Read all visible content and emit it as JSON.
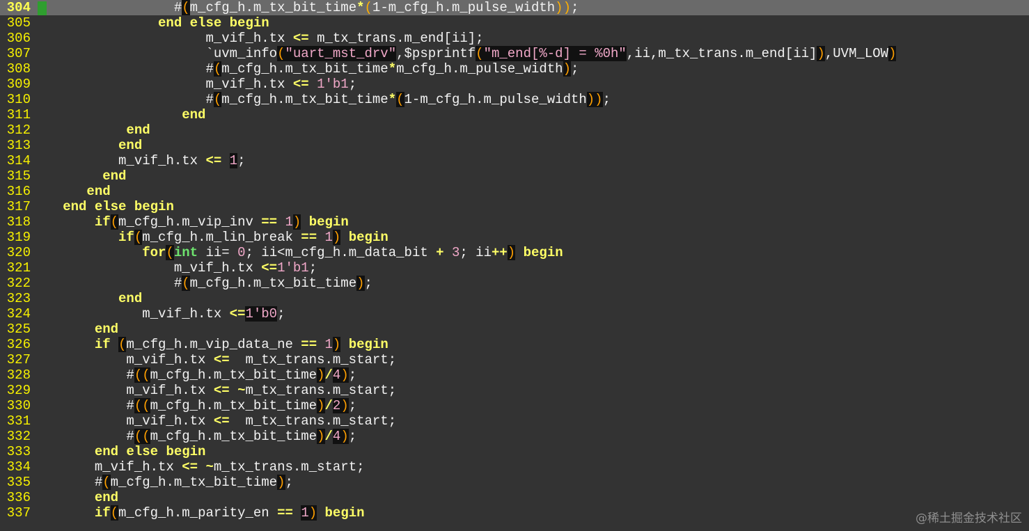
{
  "editor": {
    "current_line": 304,
    "watermark": "@稀土掘金技术社区",
    "lines": [
      {
        "n": "304",
        "indent": "                 ",
        "tokens": [
          [
            "#",
            "text"
          ],
          [
            "(",
            "paren",
            1
          ],
          [
            "m_cfg_h.m_tx_bit_time",
            "text"
          ],
          [
            "*",
            "op"
          ],
          [
            "(",
            "paren"
          ],
          [
            "1-m_cfg_h.m_pulse_width",
            "text"
          ],
          [
            "))",
            "paren"
          ],
          [
            ";",
            "text"
          ]
        ]
      },
      {
        "n": "305",
        "indent": "               ",
        "tokens": [
          [
            "end else begin",
            "kw"
          ]
        ]
      },
      {
        "n": "306",
        "indent": "                     ",
        "tokens": [
          [
            "m_vif_h.tx ",
            "text"
          ],
          [
            "<=",
            "op"
          ],
          [
            " m_tx_trans.m_end[ii];",
            "text"
          ]
        ]
      },
      {
        "n": "307",
        "indent": "                     ",
        "tokens": [
          [
            "`uvm_info",
            "text"
          ],
          [
            "(",
            "paren",
            1
          ],
          [
            "\"uart_mst_drv\"",
            "str",
            1
          ],
          [
            ",$psprintf",
            "text"
          ],
          [
            "(",
            "paren",
            1
          ],
          [
            "\"m_end[%-d] = %0h\"",
            "str",
            1
          ],
          [
            ",ii,m_tx_trans.m_end[ii]",
            "text"
          ],
          [
            ")",
            "paren",
            1
          ],
          [
            ",UVM_LOW",
            "text"
          ],
          [
            ")",
            "paren",
            1
          ]
        ]
      },
      {
        "n": "308",
        "indent": "                     ",
        "tokens": [
          [
            "#",
            "text"
          ],
          [
            "(",
            "paren",
            1
          ],
          [
            "m_cfg_h.m_tx_bit_time",
            "text"
          ],
          [
            "*",
            "op"
          ],
          [
            "m_cfg_h.m_pulse_width",
            "text"
          ],
          [
            ")",
            "paren",
            1
          ],
          [
            ";",
            "text"
          ]
        ]
      },
      {
        "n": "309",
        "indent": "                     ",
        "tokens": [
          [
            "m_vif_h.tx ",
            "text"
          ],
          [
            "<=",
            "op"
          ],
          [
            " ",
            "text"
          ],
          [
            "1'b1",
            "num"
          ],
          [
            ";",
            "text"
          ]
        ]
      },
      {
        "n": "310",
        "indent": "                     ",
        "tokens": [
          [
            "#",
            "text"
          ],
          [
            "(",
            "paren",
            1
          ],
          [
            "m_cfg_h.m_tx_bit_time",
            "text"
          ],
          [
            "*",
            "op"
          ],
          [
            "(",
            "paren",
            1
          ],
          [
            "1-m_cfg_h.m_pulse_width",
            "text"
          ],
          [
            "))",
            "paren",
            1
          ],
          [
            ";",
            "text"
          ]
        ]
      },
      {
        "n": "311",
        "indent": "                  ",
        "tokens": [
          [
            "end",
            "kw"
          ]
        ]
      },
      {
        "n": "312",
        "indent": "           ",
        "tokens": [
          [
            "end",
            "kw"
          ]
        ]
      },
      {
        "n": "313",
        "indent": "          ",
        "tokens": [
          [
            "end",
            "kw"
          ]
        ]
      },
      {
        "n": "314",
        "indent": "          ",
        "tokens": [
          [
            "m_vif_h.tx ",
            "text"
          ],
          [
            "<=",
            "op"
          ],
          [
            " ",
            "text"
          ],
          [
            "1",
            "num",
            1
          ],
          [
            ";",
            "text"
          ]
        ]
      },
      {
        "n": "315",
        "indent": "        ",
        "tokens": [
          [
            "end",
            "kw"
          ]
        ]
      },
      {
        "n": "316",
        "indent": "      ",
        "tokens": [
          [
            "end",
            "kw"
          ]
        ]
      },
      {
        "n": "317",
        "indent": "   ",
        "tokens": [
          [
            "end else begin",
            "kw"
          ]
        ]
      },
      {
        "n": "318",
        "indent": "       ",
        "tokens": [
          [
            "if",
            "kw"
          ],
          [
            "(",
            "paren",
            1
          ],
          [
            "m_cfg_h.m_vip_inv ",
            "text"
          ],
          [
            "==",
            "op"
          ],
          [
            " ",
            "text"
          ],
          [
            "1",
            "num"
          ],
          [
            ")",
            "paren",
            1
          ],
          [
            " ",
            "text"
          ],
          [
            "begin",
            "kw"
          ]
        ]
      },
      {
        "n": "319",
        "indent": "          ",
        "tokens": [
          [
            "if",
            "kw"
          ],
          [
            "(",
            "paren",
            1
          ],
          [
            "m_cfg_h.m_lin_break ",
            "text"
          ],
          [
            "==",
            "op"
          ],
          [
            " ",
            "text"
          ],
          [
            "1",
            "num"
          ],
          [
            ")",
            "paren",
            1
          ],
          [
            " ",
            "text"
          ],
          [
            "begin",
            "kw"
          ]
        ]
      },
      {
        "n": "320",
        "indent": "             ",
        "tokens": [
          [
            "for",
            "kw"
          ],
          [
            "(",
            "paren",
            1
          ],
          [
            "int",
            "type"
          ],
          [
            " ii= ",
            "text"
          ],
          [
            "0",
            "num"
          ],
          [
            "; ii<m_cfg_h.m_data_bit ",
            "text"
          ],
          [
            "+",
            "op"
          ],
          [
            " ",
            "text"
          ],
          [
            "3",
            "num"
          ],
          [
            "; ii",
            "text"
          ],
          [
            "++",
            "op"
          ],
          [
            ")",
            "paren",
            1
          ],
          [
            " ",
            "text"
          ],
          [
            "begin",
            "kw"
          ]
        ]
      },
      {
        "n": "321",
        "indent": "                 ",
        "tokens": [
          [
            "m_vif_h.tx ",
            "text"
          ],
          [
            "<=",
            "op"
          ],
          [
            "1'b1",
            "num"
          ],
          [
            ";",
            "text"
          ]
        ]
      },
      {
        "n": "322",
        "indent": "                 ",
        "tokens": [
          [
            "#",
            "text"
          ],
          [
            "(",
            "paren",
            1
          ],
          [
            "m_cfg_h.m_tx_bit_time",
            "text"
          ],
          [
            ")",
            "paren",
            1
          ],
          [
            ";",
            "text"
          ]
        ]
      },
      {
        "n": "323",
        "indent": "          ",
        "tokens": [
          [
            "end",
            "kw"
          ]
        ]
      },
      {
        "n": "324",
        "indent": "             ",
        "tokens": [
          [
            "m_vif_h.tx ",
            "text"
          ],
          [
            "<=",
            "op"
          ],
          [
            "1'b0",
            "num",
            1
          ],
          [
            ";",
            "text"
          ]
        ]
      },
      {
        "n": "325",
        "indent": "       ",
        "tokens": [
          [
            "end",
            "kw"
          ]
        ]
      },
      {
        "n": "326",
        "indent": "       ",
        "tokens": [
          [
            "if",
            "kw"
          ],
          [
            " ",
            "text"
          ],
          [
            "(",
            "paren",
            1
          ],
          [
            "m_cfg_h.m_vip_data_ne ",
            "text"
          ],
          [
            "==",
            "op"
          ],
          [
            " ",
            "text"
          ],
          [
            "1",
            "num"
          ],
          [
            ")",
            "paren",
            1
          ],
          [
            " ",
            "text"
          ],
          [
            "begin",
            "kw"
          ]
        ]
      },
      {
        "n": "327",
        "indent": "           ",
        "tokens": [
          [
            "m_vif_h.tx ",
            "text"
          ],
          [
            "<=",
            "op"
          ],
          [
            "  m_tx_trans.m_start;",
            "text"
          ]
        ]
      },
      {
        "n": "328",
        "indent": "           ",
        "tokens": [
          [
            "#",
            "text"
          ],
          [
            "((",
            "paren",
            1
          ],
          [
            "m_cfg_h.m_tx_bit_time",
            "text"
          ],
          [
            ")",
            "paren",
            1
          ],
          [
            "/",
            "op"
          ],
          [
            "4",
            "num",
            1
          ],
          [
            ")",
            "paren",
            1
          ],
          [
            ";",
            "text"
          ]
        ]
      },
      {
        "n": "329",
        "indent": "           ",
        "tokens": [
          [
            "m_vif_h.tx ",
            "text"
          ],
          [
            "<=",
            "op"
          ],
          [
            " ",
            "text"
          ],
          [
            "~",
            "op"
          ],
          [
            "m_tx_trans.m_start;",
            "text"
          ]
        ]
      },
      {
        "n": "330",
        "indent": "           ",
        "tokens": [
          [
            "#",
            "text"
          ],
          [
            "((",
            "paren",
            1
          ],
          [
            "m_cfg_h.m_tx_bit_time",
            "text"
          ],
          [
            ")",
            "paren",
            1
          ],
          [
            "/",
            "op"
          ],
          [
            "2",
            "num",
            1
          ],
          [
            ")",
            "paren",
            1
          ],
          [
            ";",
            "text"
          ]
        ]
      },
      {
        "n": "331",
        "indent": "           ",
        "tokens": [
          [
            "m_vif_h.tx ",
            "text"
          ],
          [
            "<=",
            "op"
          ],
          [
            "  m_tx_trans.m_start;",
            "text"
          ]
        ]
      },
      {
        "n": "332",
        "indent": "           ",
        "tokens": [
          [
            "#",
            "text"
          ],
          [
            "((",
            "paren",
            1
          ],
          [
            "m_cfg_h.m_tx_bit_time",
            "text"
          ],
          [
            ")",
            "paren",
            1
          ],
          [
            "/",
            "op"
          ],
          [
            "4",
            "num",
            1
          ],
          [
            ")",
            "paren",
            1
          ],
          [
            ";",
            "text"
          ]
        ]
      },
      {
        "n": "333",
        "indent": "       ",
        "tokens": [
          [
            "end else begin",
            "kw"
          ]
        ]
      },
      {
        "n": "334",
        "indent": "       ",
        "tokens": [
          [
            "m_vif_h.tx ",
            "text"
          ],
          [
            "<=",
            "op"
          ],
          [
            " ",
            "text"
          ],
          [
            "~",
            "op"
          ],
          [
            "m_tx_trans.m_start;",
            "text"
          ]
        ]
      },
      {
        "n": "335",
        "indent": "       ",
        "tokens": [
          [
            "#",
            "text"
          ],
          [
            "(",
            "paren",
            1
          ],
          [
            "m_cfg_h.m_tx_bit_time",
            "text"
          ],
          [
            ")",
            "paren",
            1
          ],
          [
            ";",
            "text"
          ]
        ]
      },
      {
        "n": "336",
        "indent": "       ",
        "tokens": [
          [
            "end",
            "kw"
          ]
        ]
      },
      {
        "n": "337",
        "indent": "       ",
        "tokens": [
          [
            "if",
            "kw"
          ],
          [
            "(",
            "paren",
            1
          ],
          [
            "m_cfg_h.m_parity_en ",
            "text"
          ],
          [
            "==",
            "op"
          ],
          [
            " ",
            "text"
          ],
          [
            "1",
            "num",
            1
          ],
          [
            ")",
            "paren",
            1
          ],
          [
            " ",
            "text"
          ],
          [
            "begin",
            "kw"
          ]
        ]
      }
    ]
  },
  "colors": {
    "background": "#333333",
    "current_line_bg": "#6a6a6a",
    "line_number": "#f7f100",
    "keyword": "#ffff66",
    "type": "#6ee36e",
    "number_string": "#f0a8c8",
    "paren": "#ffb000",
    "sign_marker": "#2f9e2f"
  }
}
